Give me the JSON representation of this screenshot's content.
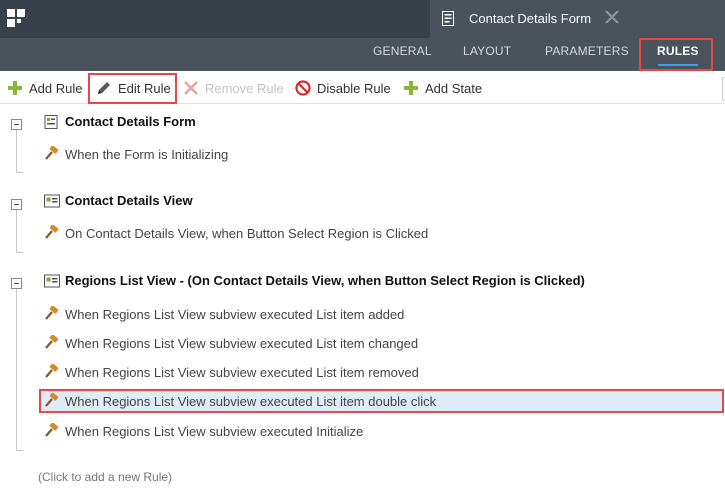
{
  "document_tab": {
    "title": "Contact Details Form"
  },
  "nav_tabs": [
    {
      "label": "GENERAL",
      "active": false
    },
    {
      "label": "LAYOUT",
      "active": false
    },
    {
      "label": "PARAMETERS",
      "active": false
    },
    {
      "label": "RULES",
      "active": true
    }
  ],
  "toolbar": {
    "add_rule": "Add Rule",
    "edit_rule": "Edit Rule",
    "remove_rule": "Remove Rule",
    "disable_rule": "Disable Rule",
    "add_state": "Add State"
  },
  "groups": [
    {
      "title": "Contact Details Form",
      "icon": "form-icon",
      "rules": [
        "When the Form is Initializing"
      ]
    },
    {
      "title": "Contact Details View",
      "icon": "view-icon",
      "rules": [
        "On Contact Details View, when Button Select Region is Clicked"
      ]
    },
    {
      "title": "Regions List View - (On Contact Details View, when Button Select Region is Clicked)",
      "icon": "list-view-icon",
      "rules": [
        "When Regions List View subview executed List item added",
        "When Regions List View subview executed List item changed",
        "When Regions List View subview executed List item removed",
        "When Regions List View subview executed List item double click",
        "When Regions List View subview executed Initialize"
      ]
    }
  ],
  "selected_rule": "When Regions List View subview executed List item double click",
  "add_rule_hint": "(Click to add a new Rule)",
  "colors": {
    "accent": "#3aa0e8",
    "highlight": "#e5474b",
    "topbar": "#39424b",
    "selection": "#ddecf8"
  }
}
